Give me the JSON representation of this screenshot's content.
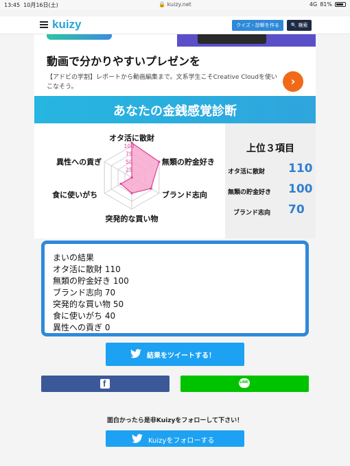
{
  "status": {
    "time": "13:45",
    "date": "10月16日(土)",
    "url": "kuizy.net",
    "network": "4G",
    "battery": "81%"
  },
  "nav": {
    "brand": "kuizy",
    "create_label": "クイズ・診断を作る",
    "search_label": "検索"
  },
  "ad": {
    "title": "動画で分かりやすいプレゼンを",
    "description": "【アドビの学割】レポートから動画編集まで。文系学生こそCreative Cloudを使いこなそう。"
  },
  "diagnosis": {
    "title": "あなたの金銭感覚診断",
    "axes": [
      "オタ活に散財",
      "無類の貯金好き",
      "ブランド志向",
      "突発的な買い物",
      "食に使いがち",
      "異性への貢ぎ"
    ],
    "ticks": [
      "25",
      "50",
      "75",
      "100"
    ],
    "top3": {
      "heading": "上位３項目",
      "items": [
        {
          "label": "オタ活に散財",
          "value": "110"
        },
        {
          "label": "無類の貯金好き",
          "value": "100"
        },
        {
          "label": "ブランド志向",
          "value": "70"
        }
      ]
    }
  },
  "chart_data": {
    "type": "radar",
    "categories": [
      "オタ活に散財",
      "無類の貯金好き",
      "ブランド志向",
      "突発的な買い物",
      "食に使いがち",
      "異性への貢ぎ"
    ],
    "values": [
      110,
      100,
      70,
      50,
      40,
      0
    ],
    "rlim": [
      0,
      100
    ],
    "ticks": [
      25,
      50,
      75,
      100
    ],
    "fill_color": "#f7a8cf",
    "stroke_color": "#e0409a"
  },
  "summary": {
    "lines": [
      "まいの結果",
      "オタ活に散財 110",
      "無類の貯金好き 100",
      "ブランド志向 70",
      "突発的な買い物 50",
      "食に使いがち 40",
      "異性への貢ぎ 0"
    ]
  },
  "share": {
    "tweet_label": "結果をツイートする！",
    "follow_prompt": "面白かったら是非Kuizyをフォローして下さい！",
    "follow_label": "Kuizyをフォローする"
  },
  "colors": {
    "accent": "#2f89d9",
    "twitter": "#1da1f2",
    "facebook": "#3b5998",
    "line": "#00c300"
  }
}
